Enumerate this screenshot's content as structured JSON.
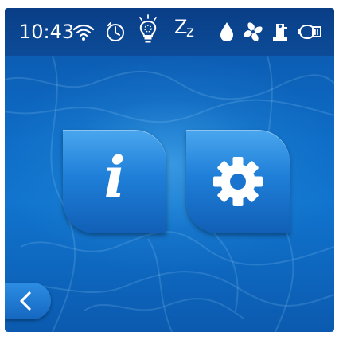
{
  "status_bar": {
    "time": "10:43",
    "icons": [
      "wifi-icon",
      "timer-icon",
      "light-bulb-icon",
      "sleep-icon",
      "water-drop-icon",
      "fan-icon",
      "heater-icon",
      "pump-icon"
    ],
    "sleep_text": "Z",
    "sleep_text_small": "z"
  },
  "tiles": {
    "info": {
      "icon": "info-icon",
      "glyph": "i"
    },
    "settings": {
      "icon": "gear-icon"
    }
  },
  "navigation": {
    "back_icon": "chevron-left-icon"
  },
  "colors": {
    "background": "#0e6cc6",
    "status_bar": "#0a3e86",
    "tile": "#1f7fd8",
    "icon": "#ffffff"
  }
}
